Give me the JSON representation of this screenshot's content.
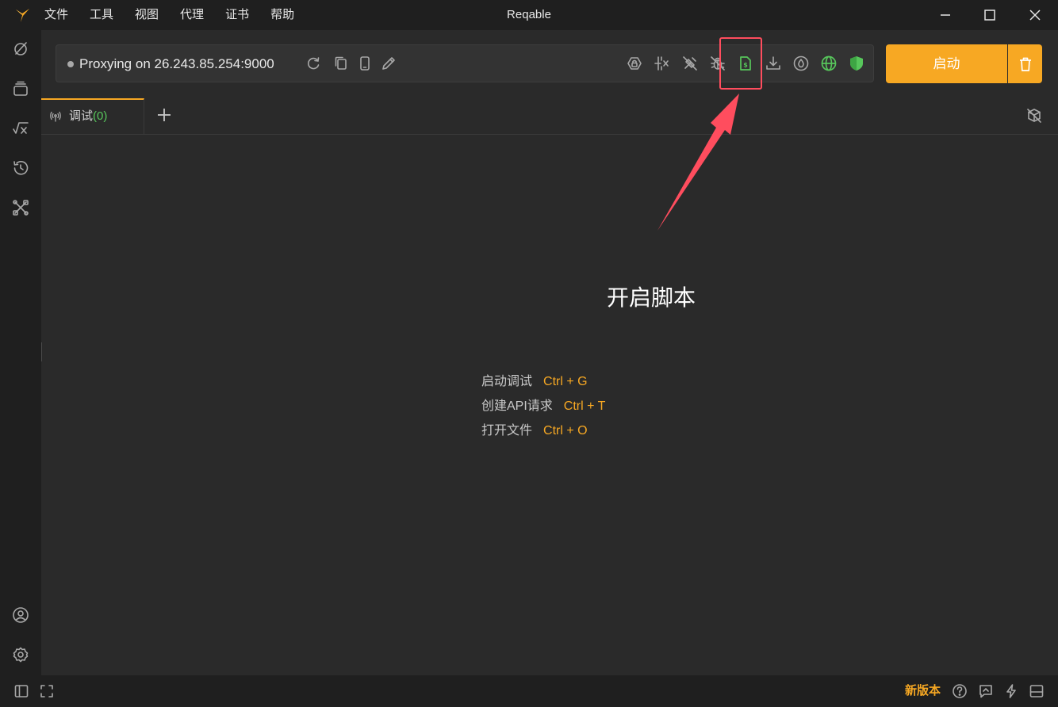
{
  "window": {
    "title": "Reqable"
  },
  "menu": {
    "items": [
      "文件",
      "工具",
      "视图",
      "代理",
      "证书",
      "帮助"
    ]
  },
  "proxy": {
    "status_text": "Proxying on 26.243.85.254:9000",
    "start_button_label": "启动",
    "toolbar_icons": [
      "ssl-lock-icon",
      "breakpoint-icon",
      "mock-off-icon",
      "bug-icon",
      "script-icon",
      "download-icon",
      "water-drop-icon",
      "network-globe-icon",
      "shield-check-icon"
    ]
  },
  "tabs": [
    {
      "label": "调试",
      "count": "(0)"
    }
  ],
  "shortcuts": [
    {
      "label": "启动调试",
      "key": "Ctrl + G"
    },
    {
      "label": "创建API请求",
      "key": "Ctrl + T"
    },
    {
      "label": "打开文件",
      "key": "Ctrl + O"
    }
  ],
  "annotation": {
    "text": "开启脚本"
  },
  "status_bar": {
    "new_version_label": "新版本"
  },
  "colors": {
    "accent": "#f7a823",
    "enabled_green": "#57c65b",
    "annotation_red": "#ff4d5e",
    "background": "#2a2a2a"
  }
}
